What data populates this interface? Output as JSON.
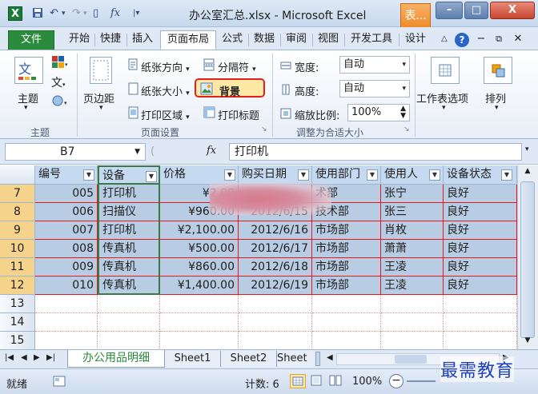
{
  "window": {
    "title": "办公室汇总.xlsx - Microsoft Excel",
    "context_tab": "表...",
    "minimize": "–",
    "maximize": "□",
    "close": "X"
  },
  "qat": {
    "undo": "↶",
    "redo": "↷",
    "new": "▯",
    "fx": "fx"
  },
  "tabs": [
    "文件",
    "开始",
    "快捷",
    "插入",
    "页面布局",
    "公式",
    "数据",
    "审阅",
    "视图",
    "开发工具",
    "设计"
  ],
  "ribbon": {
    "themes_label": "主题",
    "themes_group": "主题",
    "margins_label": "页边距",
    "orientation": "纸张方向",
    "size": "纸张大小",
    "print_area": "打印区域",
    "breaks": "分隔符",
    "background": "背景",
    "print_titles": "打印标题",
    "page_setup_group": "页面设置",
    "width_label": "宽度:",
    "width_value": "自动",
    "height_label": "高度:",
    "height_value": "自动",
    "scale_label": "缩放比例:",
    "scale_value": "100%",
    "scale_group": "调整为合适大小",
    "sheet_options": "工作表选项",
    "arrange": "排列"
  },
  "formula": {
    "name_box": "B7",
    "fx": "fx",
    "content": "打印机"
  },
  "columns": [
    "编号",
    "设备",
    "价格",
    "购买日期",
    "使用部门",
    "使用人",
    "设备状态"
  ],
  "rows": [
    {
      "num": "7",
      "id": "005",
      "device": "打印机",
      "price": "¥2,00",
      "date": "",
      "dept": "术部",
      "user": "张宁",
      "status": "良好"
    },
    {
      "num": "8",
      "id": "006",
      "device": "扫描仪",
      "price": "¥960.00",
      "date": "2012/6/15",
      "dept": "技术部",
      "user": "张三",
      "status": "良好"
    },
    {
      "num": "9",
      "id": "007",
      "device": "打印机",
      "price": "¥2,100.00",
      "date": "2012/6/16",
      "dept": "市场部",
      "user": "肖枚",
      "status": "良好"
    },
    {
      "num": "10",
      "id": "008",
      "device": "传真机",
      "price": "¥500.00",
      "date": "2012/6/17",
      "dept": "市场部",
      "user": "萧萧",
      "status": "良好"
    },
    {
      "num": "11",
      "id": "009",
      "device": "传真机",
      "price": "¥860.00",
      "date": "2012/6/18",
      "dept": "市场部",
      "user": "王凌",
      "status": "良好"
    },
    {
      "num": "12",
      "id": "010",
      "device": "传真机",
      "price": "¥1,400.00",
      "date": "2012/6/19",
      "dept": "市场部",
      "user": "王凌",
      "status": "良好"
    }
  ],
  "empty_rows": [
    "13",
    "14",
    "15"
  ],
  "sheets": [
    "办公用品明细",
    "Sheet1",
    "Sheet2",
    "Sheet"
  ],
  "status": {
    "ready": "就绪",
    "count": "计数: 6",
    "zoom": "100%",
    "minus": "−"
  },
  "watermark": "最需教育",
  "colors": {
    "header_row": "#b8cce4",
    "selected_row": "#b8cce4",
    "row_border": "#e31a1c",
    "accent_green": "#2b8b3c"
  }
}
